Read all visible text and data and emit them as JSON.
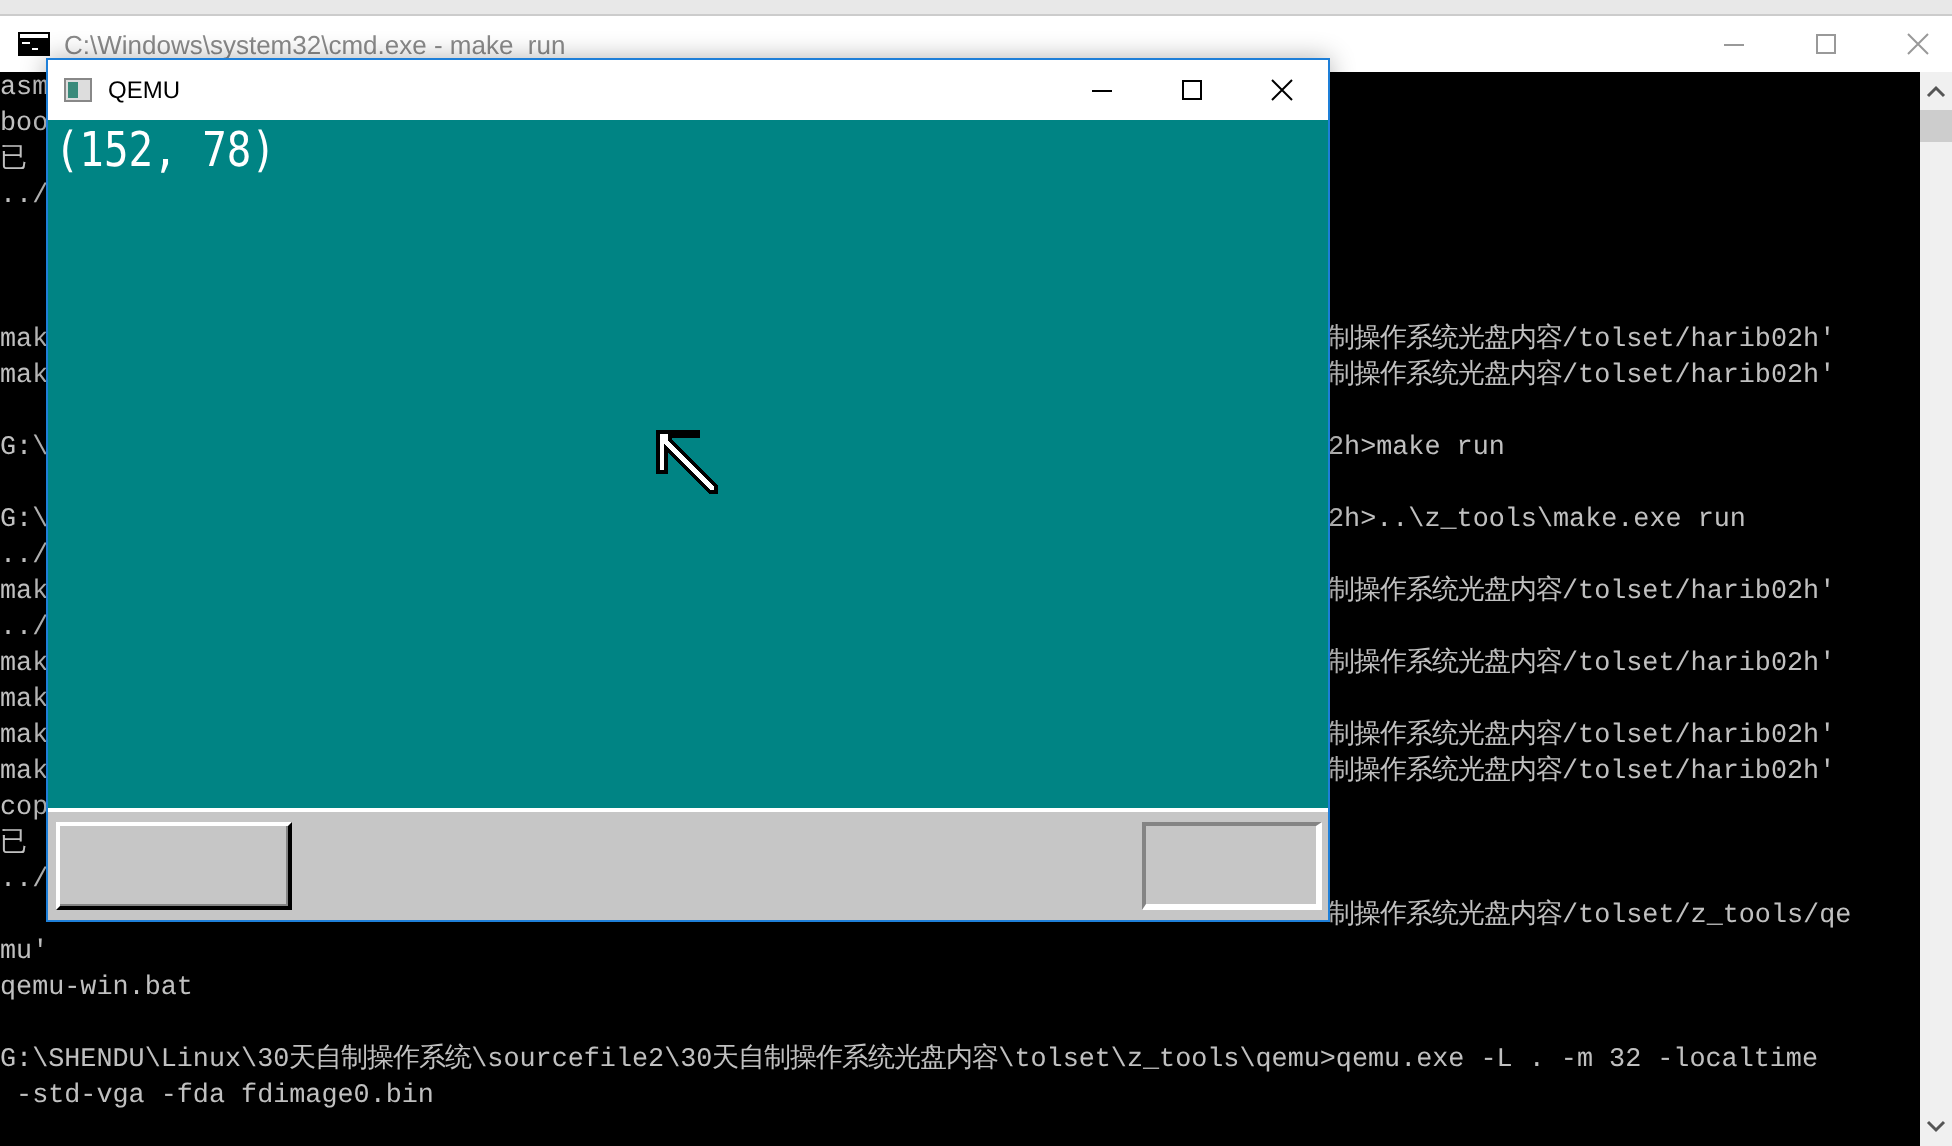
{
  "cmd_window": {
    "title": "C:\\Windows\\system32\\cmd.exe - make  run",
    "console_lines": [
      {
        "kind": "split",
        "left": "asm"
      },
      {
        "kind": "split",
        "left": "boo"
      },
      {
        "kind": "split",
        "left": "已"
      },
      {
        "kind": "split",
        "left": "../"
      },
      {
        "kind": "blank"
      },
      {
        "kind": "blank"
      },
      {
        "kind": "blank"
      },
      {
        "kind": "split",
        "left": "mak",
        "right": "制操作系统光盘内容/tolset/harib02h'"
      },
      {
        "kind": "split",
        "left": "mak",
        "right": "制操作系统光盘内容/tolset/harib02h'"
      },
      {
        "kind": "blank"
      },
      {
        "kind": "split",
        "left": "G:\\",
        "right": "2h>make run"
      },
      {
        "kind": "blank"
      },
      {
        "kind": "split",
        "left": "G:\\",
        "right": "2h>..\\z_tools\\make.exe run"
      },
      {
        "kind": "split",
        "left": "../"
      },
      {
        "kind": "split",
        "left": "mak",
        "right": "制操作系统光盘内容/tolset/harib02h'"
      },
      {
        "kind": "split",
        "left": "../"
      },
      {
        "kind": "split",
        "left": "mak",
        "right": "制操作系统光盘内容/tolset/harib02h'"
      },
      {
        "kind": "split",
        "left": "mak"
      },
      {
        "kind": "split",
        "left": "mak",
        "right": "制操作系统光盘内容/tolset/harib02h'"
      },
      {
        "kind": "split",
        "left": "mak",
        "right": "制操作系统光盘内容/tolset/harib02h'"
      },
      {
        "kind": "split",
        "left": "cop"
      },
      {
        "kind": "split",
        "left": "已"
      },
      {
        "kind": "split",
        "left": "../"
      },
      {
        "kind": "split",
        "right": "制操作系统光盘内容/tolset/z_tools/qe"
      },
      {
        "kind": "full",
        "text": "mu'"
      },
      {
        "kind": "full",
        "text": "qemu-win.bat"
      },
      {
        "kind": "blank"
      },
      {
        "kind": "full",
        "text": "G:\\SHENDU\\Linux\\30天自制操作系统\\sourcefile2\\30天自制操作系统光盘内容\\tolset\\z_tools\\qemu>qemu.exe -L . -m 32 -localtime"
      },
      {
        "kind": "full",
        "text": " -std-vga -fda fdimage0.bin"
      }
    ]
  },
  "qemu_window": {
    "title": "QEMU",
    "screen": {
      "mouse_position": "(152, 78)"
    }
  }
}
